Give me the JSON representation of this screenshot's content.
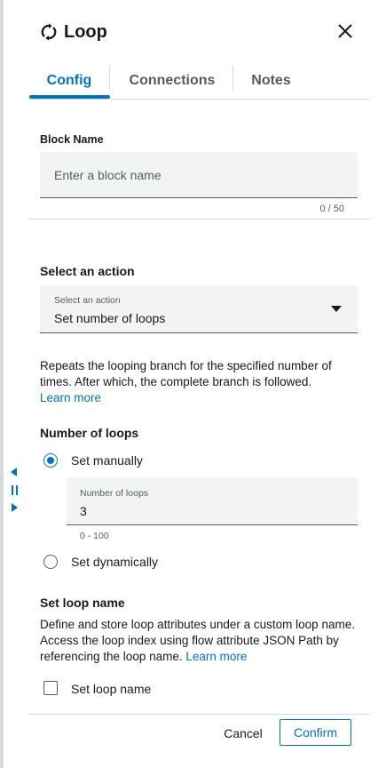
{
  "header": {
    "title": "Loop",
    "icon": "loop-icon",
    "close_icon": "close-icon"
  },
  "tabs": [
    {
      "label": "Config",
      "active": true
    },
    {
      "label": "Connections",
      "active": false
    },
    {
      "label": "Notes",
      "active": false
    }
  ],
  "block_name": {
    "label": "Block Name",
    "placeholder": "Enter a block name",
    "value": "",
    "counter": "0 / 50"
  },
  "action": {
    "section_label": "Select an action",
    "select_label": "Select an action",
    "selected_value": "Set number of loops",
    "description": "Repeats the looping branch for the specified number of times. After which, the complete branch is followed.",
    "learn_more": "Learn more"
  },
  "loops": {
    "section_label": "Number of loops",
    "option_manual": "Set manually",
    "option_dynamic": "Set dynamically",
    "selected": "manual",
    "input_label": "Number of loops",
    "value": "3",
    "range_hint": "0 - 100"
  },
  "loop_name": {
    "section_label": "Set loop name",
    "description": "Define and store loop attributes under a custom loop name. Access the loop index using flow attribute JSON Path by referencing the loop name.",
    "learn_more": "Learn more",
    "checkbox_label": "Set loop name",
    "checked": false
  },
  "footer": {
    "cancel_label": "Cancel",
    "confirm_label": "Confirm"
  },
  "colors": {
    "accent": "#0073bb",
    "field_bg": "#f2f3f3",
    "text": "#16191f",
    "muted": "#545b64",
    "divider": "#d5dbdb"
  }
}
